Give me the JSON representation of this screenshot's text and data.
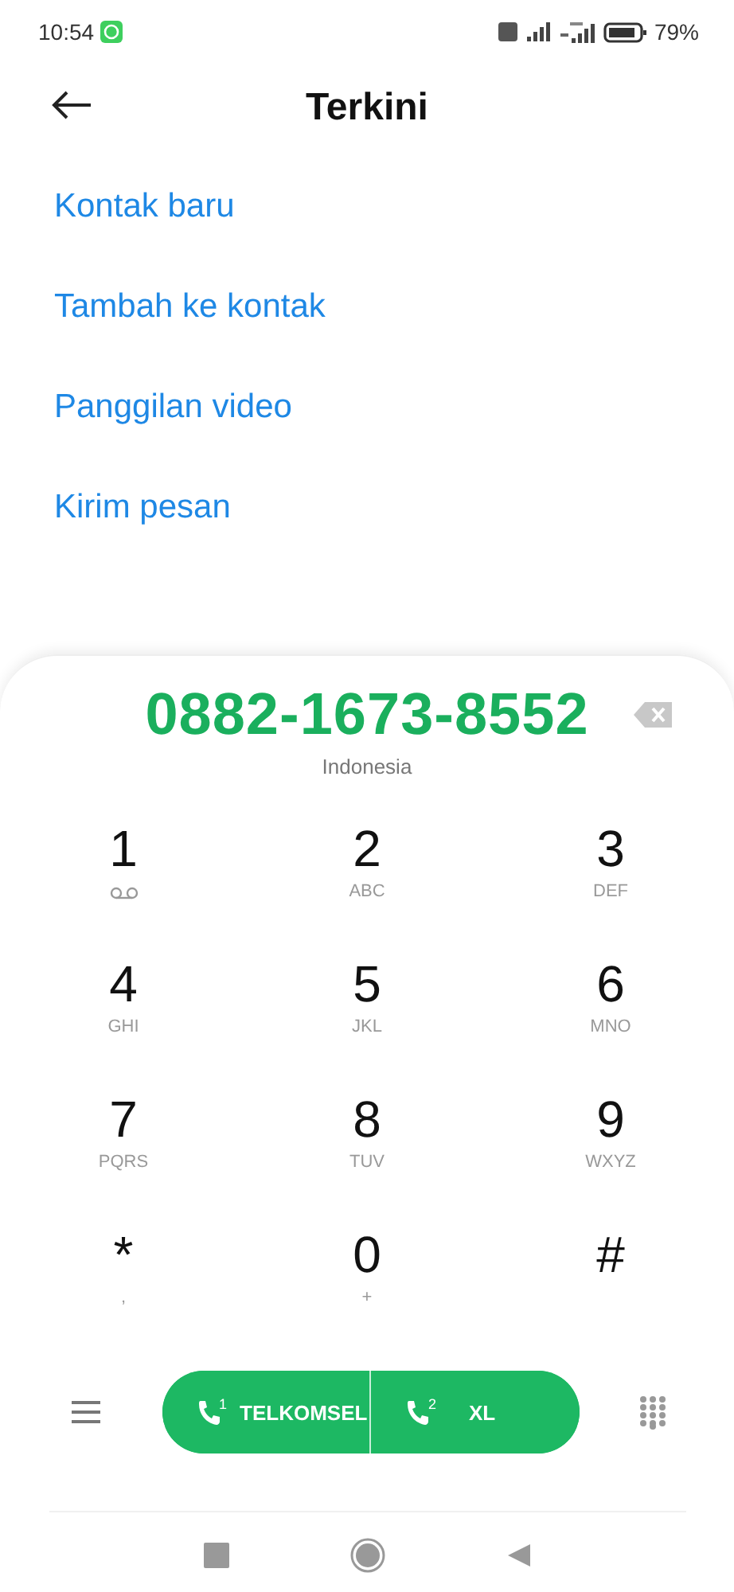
{
  "status_bar": {
    "time": "10:54",
    "battery": "79%"
  },
  "header": {
    "title": "Terkini"
  },
  "actions": [
    {
      "label": "Kontak baru"
    },
    {
      "label": "Tambah ke kontak"
    },
    {
      "label": "Panggilan video"
    },
    {
      "label": "Kirim pesan"
    }
  ],
  "dialer": {
    "number": "0882-1673-8552",
    "region": "Indonesia",
    "keys": [
      {
        "digit": "1",
        "kind": "voicemail"
      },
      {
        "digit": "2",
        "sub": "ABC",
        "kind": "letters"
      },
      {
        "digit": "3",
        "sub": "DEF",
        "kind": "letters"
      },
      {
        "digit": "4",
        "sub": "GHI",
        "kind": "letters"
      },
      {
        "digit": "5",
        "sub": "JKL",
        "kind": "letters"
      },
      {
        "digit": "6",
        "sub": "MNO",
        "kind": "letters"
      },
      {
        "digit": "7",
        "sub": "PQRS",
        "kind": "letters"
      },
      {
        "digit": "8",
        "sub": "TUV",
        "kind": "letters"
      },
      {
        "digit": "9",
        "sub": "WXYZ",
        "kind": "letters"
      },
      {
        "digit": "*",
        "sub": ",",
        "kind": "letters"
      },
      {
        "digit": "0",
        "sub": "+",
        "kind": "letters"
      },
      {
        "digit": "#",
        "kind": "plain"
      }
    ],
    "call_buttons": [
      {
        "sim": "1",
        "label": "TELKOMSEL"
      },
      {
        "sim": "2",
        "label": "XL"
      }
    ]
  }
}
